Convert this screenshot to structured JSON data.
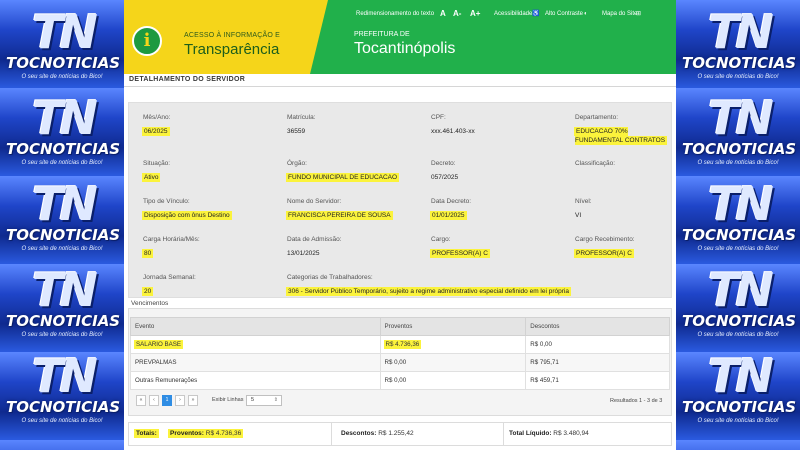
{
  "side_logo": {
    "mark": "TN",
    "word": "TOCNOTICIAS",
    "slogan": "O seu site de notícias do Bico!"
  },
  "header": {
    "brand_top": "ACESSO À INFORMAÇÃO E",
    "brand_main": "Transparência",
    "pref_top": "PREFEITURA DE",
    "pref_main": "Tocantinópolis",
    "accessibility": {
      "resize_label": "Redimensionamento do texto",
      "font_a": "A",
      "font_minus": "A-",
      "font_plus": "A+",
      "acessibilidade": "Acessibilidade",
      "alto_contraste": "Alto Contraste",
      "mapa": "Mapa do Site"
    },
    "colors": {
      "yellow": "#f5d51a",
      "green": "#21b04b"
    }
  },
  "section_title": "DETALHAMENTO DO SERVIDOR",
  "fields": {
    "mes_ano": {
      "label": "Mês/Ano:",
      "value": "06/2025"
    },
    "matricula": {
      "label": "Matrícula:",
      "value": "36559"
    },
    "cpf": {
      "label": "CPF:",
      "value": "xxx.461.403-xx"
    },
    "departamento": {
      "label": "Departamento:",
      "value": "EDUCACAO 70% FUNDAMENTAL CONTRATOS"
    },
    "situacao": {
      "label": "Situação:",
      "value": "Ativo"
    },
    "orgao": {
      "label": "Órgão:",
      "value": "FUNDO MUNICIPAL DE EDUCACAO"
    },
    "decreto": {
      "label": "Decreto:",
      "value": "057/2025"
    },
    "classificacao": {
      "label": "Classificação:",
      "value": ""
    },
    "tipo_vinculo": {
      "label": "Tipo de Vínculo:",
      "value": "Disposição com ônus Destino"
    },
    "nome": {
      "label": "Nome do Servidor:",
      "value": "FRANCISCA PEREIRA DE SOUSA"
    },
    "data_decreto": {
      "label": "Data Decreto:",
      "value": "01/01/2025"
    },
    "nivel": {
      "label": "Nível:",
      "value": "VI"
    },
    "carga": {
      "label": "Carga Horária/Mês:",
      "value": "80"
    },
    "admissao": {
      "label": "Data de Admissão:",
      "value": "13/01/2025"
    },
    "cargo": {
      "label": "Cargo:",
      "value": "PROFESSOR(A) C"
    },
    "cargo_recebimento": {
      "label": "Cargo Recebimento:",
      "value": "PROFESSOR(A) C"
    },
    "jornada": {
      "label": "Jornada Semanal:",
      "value": "20"
    },
    "categorias": {
      "label": "Categorias de Trabalhadores:",
      "value": "306 - Servidor Público Temporário, sujeito a regime administrativo especial definido em lei própria"
    }
  },
  "vencimentos": {
    "title": "Vencimentos",
    "headers": [
      "Evento",
      "Proventos",
      "Descontos"
    ],
    "rows": [
      {
        "evento": "SALARIO BASE",
        "proventos": "R$ 4.736,36",
        "descontos": "R$ 0,00"
      },
      {
        "evento": "PREVPALMAS",
        "proventos": "R$ 0,00",
        "descontos": "R$ 795,71"
      },
      {
        "evento": "Outras Remunerações",
        "proventos": "R$ 0,00",
        "descontos": "R$ 459,71"
      }
    ],
    "pager": {
      "first": "«",
      "prev": "‹",
      "page": "1",
      "next": "›",
      "last": "»",
      "exibir_label": "Exibir Linhas",
      "exibir_value": "5",
      "results": "Resultados 1 - 3 de 3"
    }
  },
  "totals": {
    "label": "Totais:",
    "proventos_label": "Proventos:",
    "proventos_value": "R$ 4.736,36",
    "descontos_label": "Descontos:",
    "descontos_value": "R$ 1.255,42",
    "liquido_label": "Total Líquido:",
    "liquido_value": "R$ 3.480,94"
  }
}
